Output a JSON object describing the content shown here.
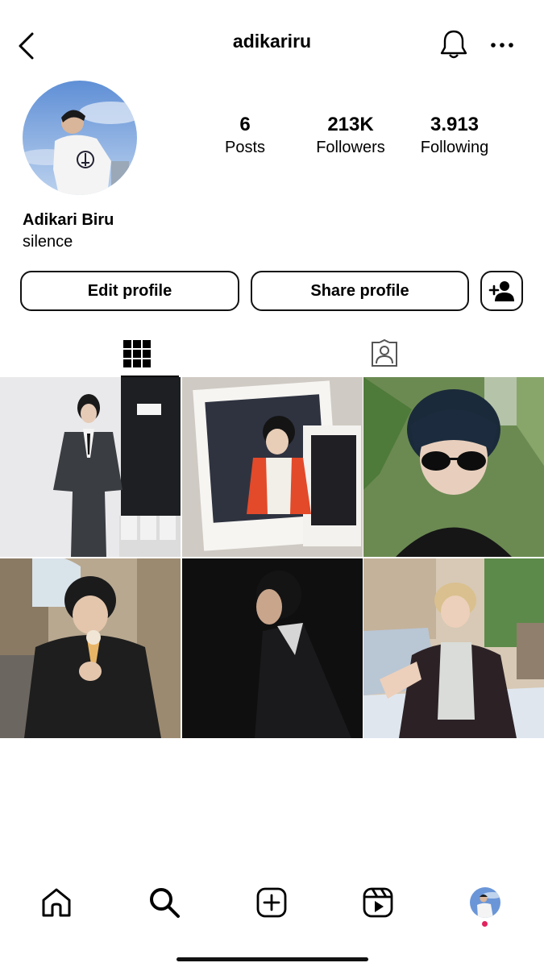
{
  "header": {
    "username": "adikariru",
    "back_icon": "chevron-left-icon",
    "bell_icon": "bell-icon",
    "more_icon": "more-horizontal-icon"
  },
  "profile": {
    "display_name": "Adikari Biru",
    "bio": "silence",
    "stats": {
      "posts": {
        "count": "6",
        "label": "Posts"
      },
      "followers": {
        "count": "213K",
        "label": "Followers"
      },
      "following": {
        "count": "3.913",
        "label": "Following"
      }
    }
  },
  "actions": {
    "edit_label": "Edit profile",
    "share_label": "Share profile",
    "add_icon": "person-add-icon"
  },
  "tabs": [
    {
      "icon": "grid-icon",
      "active": true
    },
    {
      "icon": "tagged-person-icon",
      "active": false
    }
  ],
  "posts_count_shown": 6,
  "nav": {
    "items": [
      "home-icon",
      "search-icon",
      "create-icon",
      "reels-icon",
      "profile-avatar"
    ],
    "notification_dot_color": "#e0245e"
  },
  "colors": {
    "text": "#000000",
    "background": "#ffffff"
  }
}
